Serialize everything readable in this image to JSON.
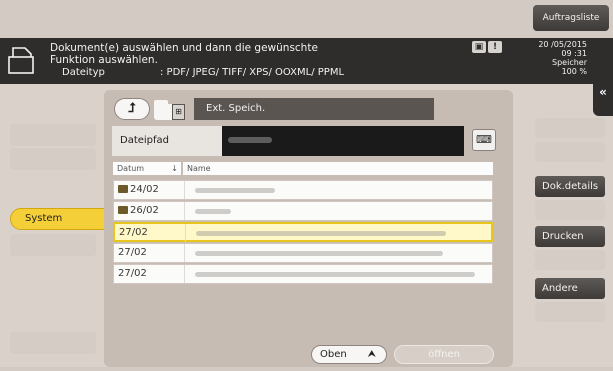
{
  "header": {
    "job_list_label": "Auftragsliste"
  },
  "message": {
    "line1": "Dokument(e) auswählen und dann die gewünschte",
    "line2": "Funktion auswählen.",
    "file_type_label": "Dateityp",
    "file_types": ": PDF/ JPEG/ TIFF/ XPS/ OOXML/ PPML"
  },
  "status": {
    "date": "20 /05/2015",
    "time": "09 :31",
    "memory_label": "Speicher",
    "memory_percent": "100 %"
  },
  "left_nav": {
    "active_item": "System"
  },
  "browser": {
    "location_label": "Ext. Speich.",
    "path_label": "Dateipfad",
    "columns": {
      "date": "Datum",
      "name": "Name"
    },
    "rows": [
      {
        "date": "24/02",
        "is_folder": true,
        "selected": false,
        "blur_width": 80
      },
      {
        "date": "26/02",
        "is_folder": true,
        "selected": false,
        "blur_width": 36
      },
      {
        "date": "27/02",
        "is_folder": false,
        "selected": true,
        "blur_width": 250
      },
      {
        "date": "27/02",
        "is_folder": false,
        "selected": false,
        "blur_width": 248
      },
      {
        "date": "27/02",
        "is_folder": false,
        "selected": false,
        "blur_width": 280
      }
    ],
    "top_button_label": "Oben",
    "open_button_label": "öffnen"
  },
  "right_nav": {
    "doc_details_label": "Dok.details",
    "print_label": "Drucken",
    "other_label": "Andere"
  },
  "colors": {
    "accent_yellow": "#f5cf38",
    "dark_bar": "#2f2d2c",
    "panel": "#c6bcb4"
  }
}
